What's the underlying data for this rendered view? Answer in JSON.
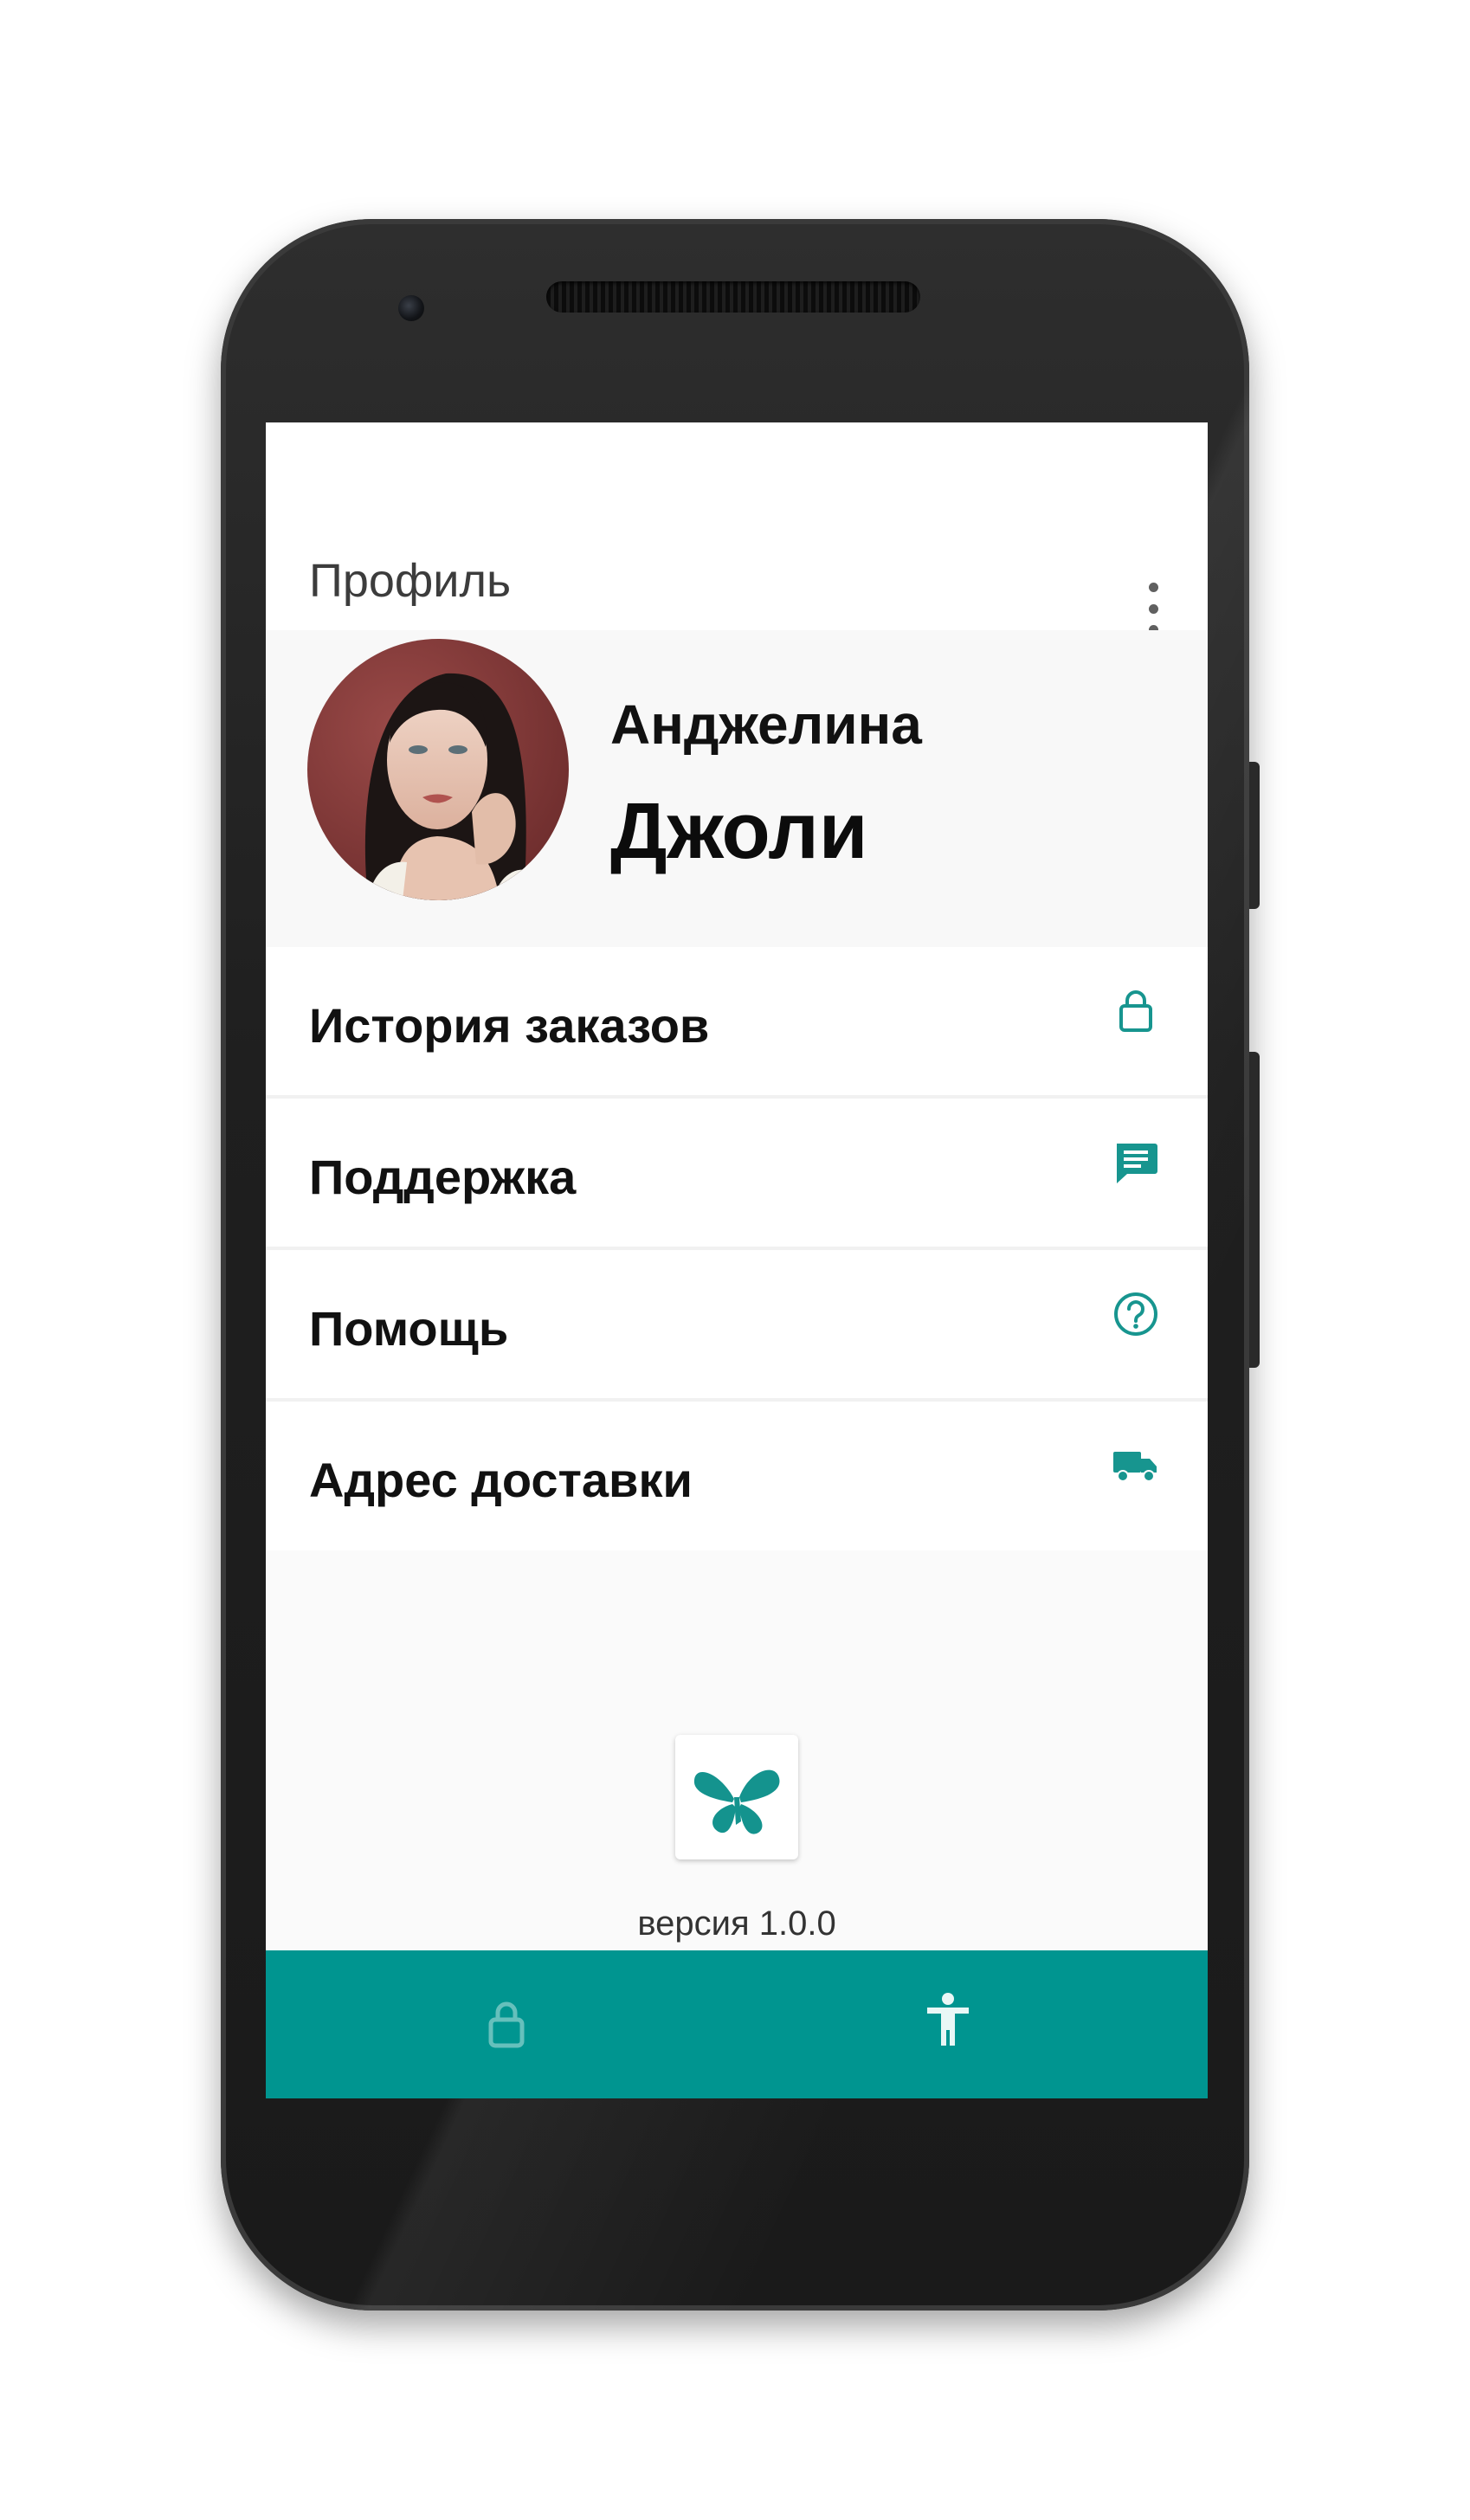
{
  "colors": {
    "accent": "#009590",
    "icon_accent": "#17958f",
    "nav_inactive": "#66c0bc",
    "nav_active": "#e9f7f6"
  },
  "header": {
    "title": "Профиль",
    "overflow_icon": "more-vert-icon"
  },
  "profile": {
    "first_name": "Анджелина",
    "last_name": "Джоли",
    "avatar": "user-avatar-photo"
  },
  "menu": {
    "items": [
      {
        "label": "История заказов",
        "icon": "shopping-bag-icon"
      },
      {
        "label": "Поддержка",
        "icon": "chat-message-icon"
      },
      {
        "label": "Помощь",
        "icon": "help-circle-icon"
      },
      {
        "label": "Адрес доставки",
        "icon": "delivery-truck-icon"
      }
    ]
  },
  "footer": {
    "logo_icon": "butterfly-logo-icon",
    "version": "версия 1.0.0"
  },
  "bottom_nav": {
    "tabs": [
      {
        "icon": "shopping-bag-icon",
        "active": false
      },
      {
        "icon": "person-icon",
        "active": true
      }
    ]
  }
}
